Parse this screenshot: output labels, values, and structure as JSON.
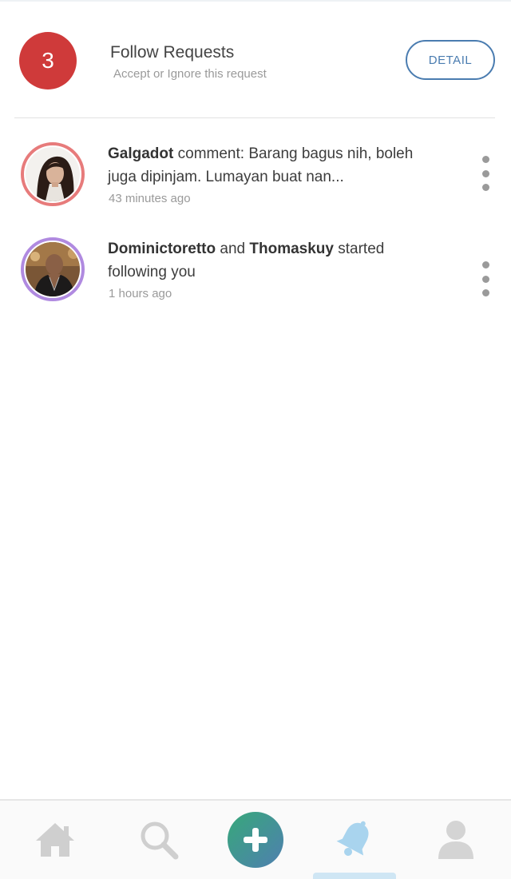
{
  "follow_requests": {
    "count": "3",
    "title": "Follow Requests",
    "subtitle": "Accept or Ignore this request",
    "detail_label": "DETAIL"
  },
  "notifications": [
    {
      "user": "Galgadot",
      "message": " comment: Barang bagus nih, boleh juga dipinjam. Lumayan buat nan...",
      "time": "43 minutes ago",
      "avatar_ring_color": "#e77b7b"
    },
    {
      "user": "Dominictoretto",
      "connector": " and ",
      "user2": "Thomaskuy",
      "message": " started following you",
      "time": "1 hours ago",
      "avatar_ring_color": "#b08ae0"
    }
  ],
  "bottom_nav": {
    "items": [
      {
        "icon": "home-icon"
      },
      {
        "icon": "search-icon"
      },
      {
        "icon": "add-icon"
      },
      {
        "icon": "bell-icon",
        "active": true
      },
      {
        "icon": "profile-icon"
      }
    ],
    "active_color": "#a9d4ee",
    "inactive_color": "#c9c9c9"
  },
  "colors": {
    "badge": "#cf3a3a",
    "accent": "#4a7cb0"
  }
}
